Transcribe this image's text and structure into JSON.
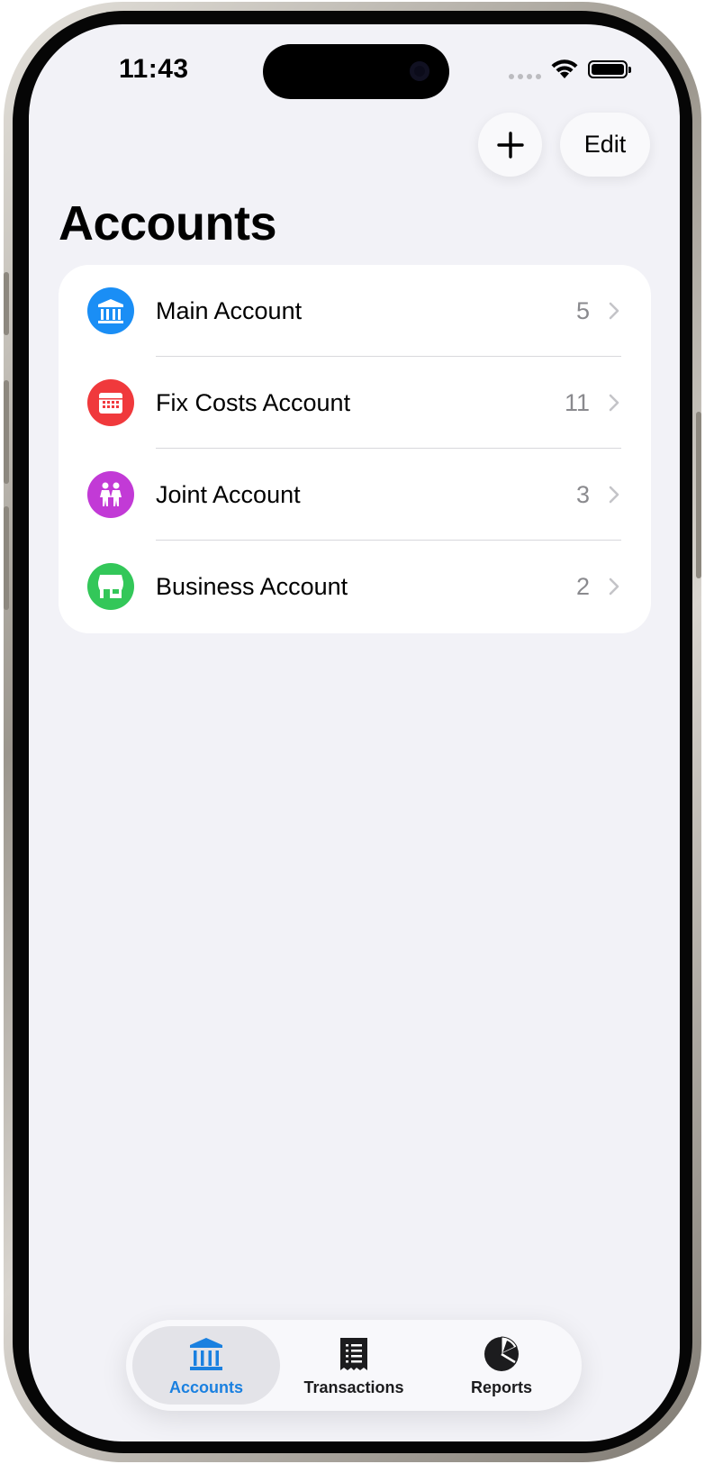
{
  "status_bar": {
    "time": "11:43"
  },
  "nav": {
    "add_icon": "plus-icon",
    "edit_label": "Edit"
  },
  "page": {
    "title": "Accounts"
  },
  "accounts": [
    {
      "name": "Main Account",
      "count": "5",
      "icon": "bank-icon",
      "color": "#1a8ef5"
    },
    {
      "name": "Fix Costs Account",
      "count": "11",
      "icon": "calendar-icon",
      "color": "#f0393c"
    },
    {
      "name": "Joint Account",
      "count": "3",
      "icon": "people-icon",
      "color": "#c23ad6"
    },
    {
      "name": "Business Account",
      "count": "2",
      "icon": "storefront-icon",
      "color": "#33c759"
    }
  ],
  "tabbar": {
    "tabs": [
      {
        "label": "Accounts",
        "icon": "bank-icon",
        "active": true
      },
      {
        "label": "Transactions",
        "icon": "receipt-icon",
        "active": false
      },
      {
        "label": "Reports",
        "icon": "pie-chart-icon",
        "active": false
      }
    ]
  },
  "colors": {
    "accent": "#1a80e0",
    "background": "#f2f2f7"
  }
}
